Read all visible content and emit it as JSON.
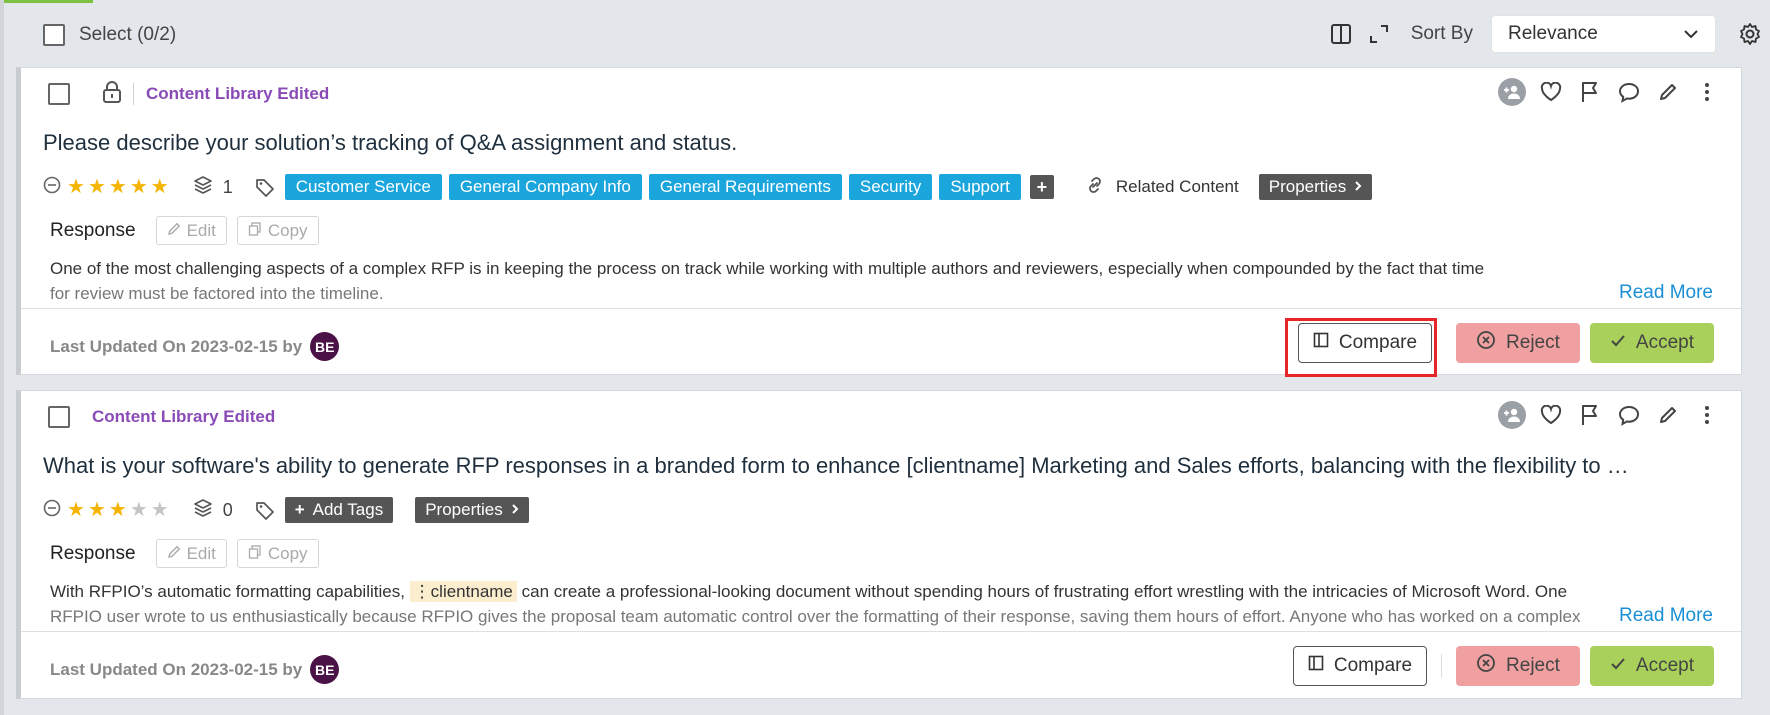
{
  "toolbar": {
    "select_label": "Select (0/2)",
    "sort_label": "Sort By",
    "sort_value": "Relevance"
  },
  "cards": [
    {
      "status": "Content Library Edited",
      "locked": true,
      "question": "Please describe your solution’s tracking of Q&A assignment and status.",
      "rating": 5,
      "layers_count": "1",
      "tags": [
        "Customer Service",
        "General Company Info",
        "General Requirements",
        "Security",
        "Support"
      ],
      "tag_more": "+",
      "related_label": "Related Content",
      "properties_label": "Properties",
      "response_label": "Response",
      "edit_label": "Edit",
      "copy_label": "Copy",
      "response_line1": "One of the most challenging aspects of a complex RFP is in keeping the process on track while working with multiple authors and reviewers, especially when compounded by the fact that time",
      "response_line2": "for review must be factored into the timeline.",
      "read_more": "Read More",
      "last_updated": "Last Updated On 2023-02-15 by",
      "avatar": "BE",
      "compare_label": "Compare",
      "reject_label": "Reject",
      "accept_label": "Accept"
    },
    {
      "status": "Content Library Edited",
      "locked": false,
      "question": "What is your software's ability to generate RFP responses in a branded form to enhance [clientname] Marketing and Sales efforts, balancing with the flexibility to …",
      "rating": 3,
      "layers_count": "0",
      "add_tags_label": "Add Tags",
      "properties_label": "Properties",
      "response_label": "Response",
      "edit_label": "Edit",
      "copy_label": "Copy",
      "response_line1_a": "With RFPIO’s automatic formatting capabilities,",
      "response_token": "clientname",
      "response_line1_b": "can create a professional-looking document without spending hours of frustrating effort wrestling with the intricacies of Microsoft Word. One",
      "response_line2": "RFPIO user wrote to us enthusiastically because RFPIO gives the proposal team automatic control over the formatting of their response, saving them hours of effort. Anyone who has worked on a complex",
      "read_more": "Read More",
      "last_updated": "Last Updated On 2023-02-15 by",
      "avatar": "BE",
      "compare_label": "Compare",
      "reject_label": "Reject",
      "accept_label": "Accept"
    }
  ],
  "colors": {
    "accent_green": "#7cc242",
    "status_purple": "#8a4bb7",
    "tag_blue": "#1aa5dd",
    "reject": "#f0a0a0",
    "accept": "#a9d05a",
    "link": "#1a8fd6",
    "highlight": "#e8262a"
  }
}
